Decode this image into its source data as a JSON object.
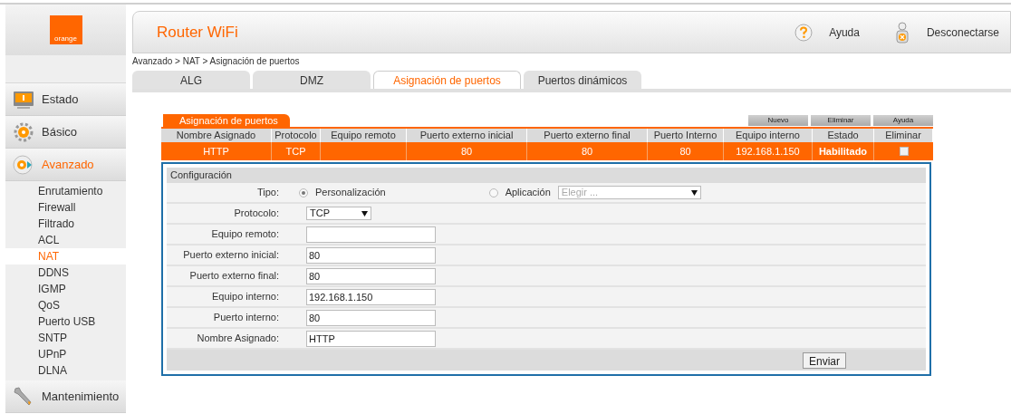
{
  "logo": "orange",
  "sidebar": [
    {
      "label": "Estado",
      "selected": false
    },
    {
      "label": "Básico",
      "selected": false
    },
    {
      "label": "Avanzado",
      "selected": true,
      "children": [
        {
          "label": "Enrutamiento",
          "selected": false
        },
        {
          "label": "Firewall",
          "selected": false
        },
        {
          "label": "Filtrado",
          "selected": false
        },
        {
          "label": "ACL",
          "selected": false
        },
        {
          "label": "NAT",
          "selected": true
        },
        {
          "label": "DDNS",
          "selected": false
        },
        {
          "label": "IGMP",
          "selected": false
        },
        {
          "label": "QoS",
          "selected": false
        },
        {
          "label": "Puerto USB",
          "selected": false
        },
        {
          "label": "SNTP",
          "selected": false
        },
        {
          "label": "UPnP",
          "selected": false
        },
        {
          "label": "DLNA",
          "selected": false
        }
      ]
    },
    {
      "label": "Mantenimiento",
      "selected": false
    }
  ],
  "header": {
    "title": "Router WiFi",
    "help": "Ayuda",
    "logout": "Desconectarse"
  },
  "breadcrumb": "Avanzado > NAT > Asignación de puertos",
  "tabs": [
    {
      "label": "ALG",
      "selected": false
    },
    {
      "label": "DMZ",
      "selected": false
    },
    {
      "label": "Asignación de puertos",
      "selected": true
    },
    {
      "label": "Puertos dinámicos",
      "selected": false
    }
  ],
  "table": {
    "title": "Asignación de puertos",
    "buttons": [
      "Nuevo",
      "Eliminar",
      "Ayuda"
    ],
    "columns": [
      "Nombre Asignado",
      "Protocolo",
      "Equipo remoto",
      "Puerto externo inicial",
      "Puerto externo final",
      "Puerto Interno",
      "Equipo interno",
      "Estado",
      "Eliminar"
    ],
    "rows": [
      {
        "cells": [
          "HTTP",
          "TCP",
          "",
          "80",
          "80",
          "80",
          "192.168.1.150",
          "Habilitado"
        ],
        "checked": false
      }
    ]
  },
  "config": {
    "title": "Configuración",
    "rows": [
      {
        "kind": "radio",
        "label": "Tipo:",
        "options": [
          {
            "label": "Personalización",
            "selected": true
          },
          {
            "label": "Aplicación",
            "selected": false,
            "placeholder": "Elegir ..."
          }
        ]
      },
      {
        "kind": "select",
        "label": "Protocolo:",
        "value": "TCP"
      },
      {
        "kind": "input",
        "label": "Equipo remoto:"
      },
      {
        "kind": "input",
        "label": "Puerto externo inicial:",
        "value": "80"
      },
      {
        "kind": "input",
        "label": "Puerto externo final:",
        "value": "80"
      },
      {
        "kind": "input",
        "label": "Equipo interno:",
        "value": "192.168.1.150"
      },
      {
        "kind": "input",
        "label": "Puerto interno:",
        "value": "80"
      },
      {
        "kind": "input",
        "label": "Nombre Asignado:",
        "value": "HTTP"
      }
    ],
    "submit": "Enviar"
  }
}
